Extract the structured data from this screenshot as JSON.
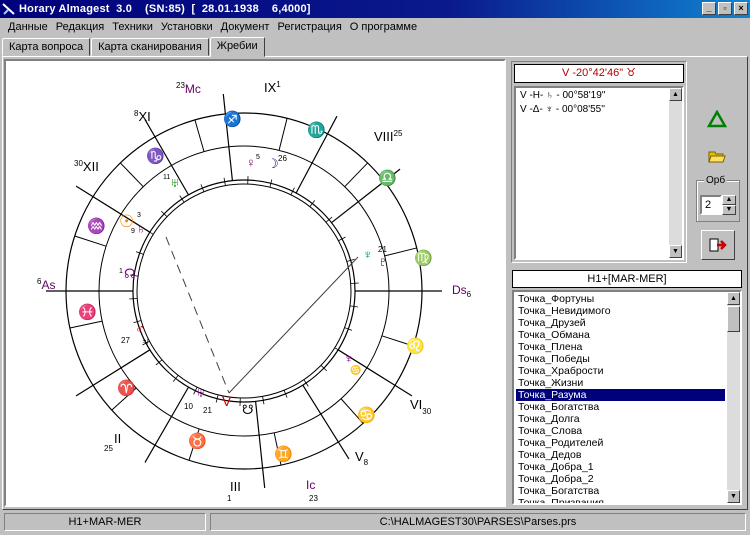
{
  "window": {
    "title": "Horary Almagest  3.0    (SN:85)  [  28.01.1938    6,4000]",
    "controls": [
      "_",
      "▫",
      "×"
    ]
  },
  "menu": [
    "Данные",
    "Редакция",
    "Техники",
    "Установки",
    "Документ",
    "Регистрация",
    "О программе"
  ],
  "tabs": [
    {
      "label": "Карта вопроса",
      "active": false
    },
    {
      "label": "Карта сканирования",
      "active": false
    },
    {
      "label": "Жребии",
      "active": true
    }
  ],
  "chart": {
    "cusps": {
      "asc": {
        "name": "As",
        "degree": "6"
      },
      "dsc": {
        "name": "Ds",
        "degree": "6"
      },
      "mc": {
        "name": "Mc",
        "degree": "23"
      },
      "ic": {
        "name": "Ic",
        "degree": "23"
      },
      "h2": {
        "name": "II",
        "degree": "25"
      },
      "h3": {
        "name": "III",
        "degree": "1"
      },
      "h5": {
        "name": "V",
        "degree": "8"
      },
      "h6": {
        "name": "VI",
        "degree": "30"
      },
      "h8": {
        "name": "VIII",
        "degree": "25"
      },
      "h9": {
        "name": "IX",
        "degree": "1"
      },
      "h11": {
        "name": "XI",
        "degree": "8"
      },
      "h12": {
        "name": "XII",
        "degree": "30"
      }
    },
    "signs": [
      "♐",
      "♏",
      "♎",
      "♍",
      "♌",
      "♋",
      "♊",
      "♉",
      "♈",
      "♓",
      "♒",
      "♑"
    ],
    "planets": [
      {
        "glyph": "♀",
        "degree": "5"
      },
      {
        "glyph": "☽",
        "degree": "26"
      },
      {
        "glyph": "♅",
        "degree": "11"
      },
      {
        "glyph": "☉",
        "degree": "3"
      },
      {
        "glyph": "♄",
        "degree": "9"
      },
      {
        "glyph": "♆",
        "degree": "21"
      },
      {
        "glyph": "♇",
        "degree": ""
      },
      {
        "glyph": "☊",
        "degree": "1"
      },
      {
        "glyph": "♂",
        "degree": "27"
      },
      {
        "glyph": "♃",
        "degree": "12"
      },
      {
        "glyph": "♅",
        "degree": "10"
      },
      {
        "glyph": "V",
        "degree": "21"
      },
      {
        "glyph": "☋",
        "degree": ""
      }
    ],
    "colors": {
      "aspect_line": "#404040",
      "purple": "#800080",
      "green": "#008000",
      "orange": "#ff8000",
      "red": "#cc0000",
      "blue": "#000080"
    }
  },
  "aspects": {
    "header": "V -20°42'46\" ♉",
    "rows": [
      "V -H- ♄ - 00°58'19''",
      "V -Δ- ♆ - 00°08'55''"
    ]
  },
  "tools": {
    "moon_icon": "moon-icon",
    "triangle_icon": "triangle-icon",
    "folder_icon": "folder-icon",
    "exit_icon": "exit-icon",
    "orb_label": "Орб",
    "orb_value": "2"
  },
  "parts": {
    "header": "H1+[MAR-MER]",
    "items": [
      "Точка_Фортуны",
      "Точка_Невидимого",
      "Точка_Друзей",
      "Точка_Обмана",
      "Точка_Плена",
      "Точка_Победы",
      "Точка_Храбрости",
      "Точка_Жизни",
      "Точка_Разума",
      "Точка_Богатства",
      "Точка_Долга",
      "Точка_Слова",
      "Точка_Родителей",
      "Точка_Дедов",
      "Точка_Добра_1",
      "Точка_Добра_2",
      "Точка_Богатства",
      "Точка_Призвания"
    ],
    "selected_index": 8
  },
  "status": {
    "left": "H1+MAR-MER",
    "right": "C:\\HALMAGEST30\\PARSES\\Parses.prs"
  }
}
